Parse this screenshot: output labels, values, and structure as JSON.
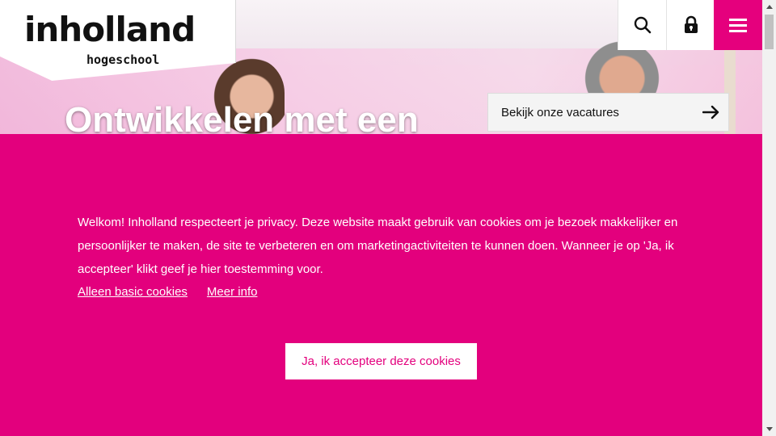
{
  "brand": {
    "logo_text": "inholland",
    "logo_subtext": "hogeschool"
  },
  "header": {
    "icons": [
      "search-icon",
      "lock-icon",
      "hamburger-menu-icon"
    ]
  },
  "hero": {
    "headline": "Ontwikkelen met een",
    "vacatures_label": "Bekijk onze vacatures"
  },
  "cookie": {
    "message": "Welkom! Inholland respecteert je privacy. Deze website maakt gebruik van cookies om je bezoek makkelijker en persoonlijker te maken, de site te verbeteren en om marketingactiviteiten te kunnen doen. Wanneer je op 'Ja, ik accepteer' klikt geef je hier toestemming voor.",
    "basic_link": "Alleen basic cookies",
    "info_link": "Meer info",
    "accept_label": "Ja, ik accepteer deze cookies"
  },
  "colors": {
    "brand_magenta": "#e3007d",
    "white": "#ffffff"
  }
}
